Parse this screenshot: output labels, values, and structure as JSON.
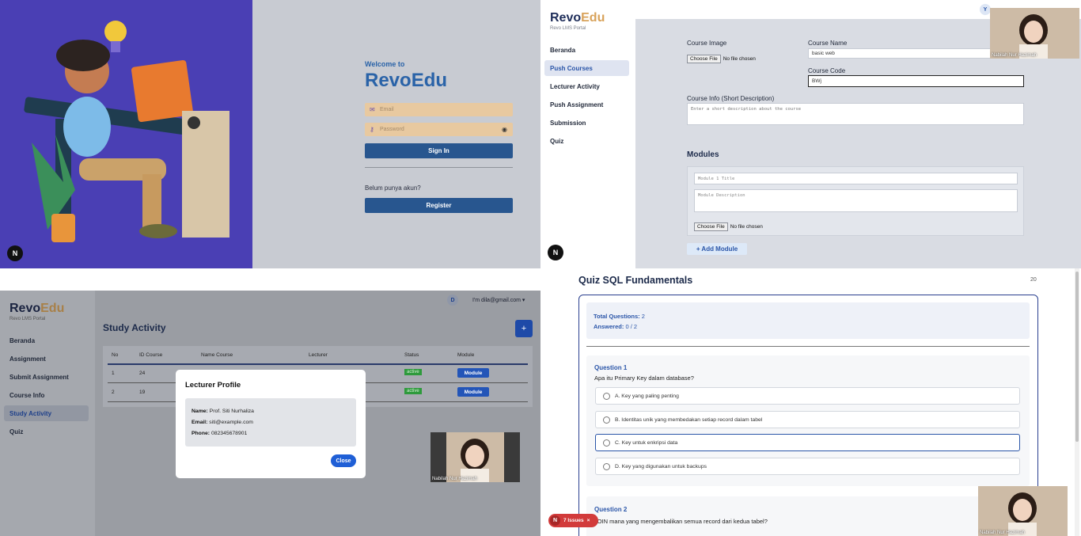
{
  "login": {
    "welcome": "Welcome to",
    "brand": "RevoEdu",
    "email_placeholder": "Email",
    "password_placeholder": "Password",
    "sign_in": "Sign In",
    "no_account": "Belum punya akun?",
    "register": "Register",
    "n_badge": "N"
  },
  "push": {
    "brand_revo": "Revo",
    "brand_edu": "Edu",
    "brand_sub": "Revo LMS Portal",
    "nav": [
      {
        "label": "Beranda"
      },
      {
        "label": "Push Courses"
      },
      {
        "label": "Lecturer Activity"
      },
      {
        "label": "Push Assignment"
      },
      {
        "label": "Submission"
      },
      {
        "label": "Quiz"
      }
    ],
    "avatar_letter": "Y",
    "course_image_label": "Course Image",
    "choose_file": "Choose File",
    "no_file": "No file chosen",
    "course_name_label": "Course Name",
    "course_name_value": "basic web",
    "course_code_label": "Course Code",
    "course_code_value": "BWj",
    "course_info_label": "Course Info (Short Description)",
    "course_info_placeholder": "Enter a short description about the course",
    "modules_title": "Modules",
    "module_title_placeholder": "Module 1 Title",
    "module_desc_placeholder": "Module Description",
    "add_module": "+ Add Module",
    "n_badge": "N",
    "video_name": "Nabilah Nur Hazimah"
  },
  "study": {
    "brand_revo": "Revo",
    "brand_edu": "Edu",
    "brand_sub": "Revo LMS Portal",
    "nav": [
      {
        "label": "Beranda"
      },
      {
        "label": "Assignment"
      },
      {
        "label": "Submit Assignment"
      },
      {
        "label": "Course Info"
      },
      {
        "label": "Study Activity"
      },
      {
        "label": "Quiz"
      }
    ],
    "avatar_letter": "D",
    "user_menu": "I'm dila@gmail.com ▾",
    "title": "Study Activity",
    "add": "+",
    "columns": [
      "No",
      "ID Course",
      "Name Course",
      "Lecturer",
      "Status",
      "Module"
    ],
    "rows": [
      {
        "no": "1",
        "id": "24",
        "status": "active",
        "module": "Module"
      },
      {
        "no": "2",
        "id": "19",
        "status": "active",
        "module": "Module"
      }
    ],
    "modal": {
      "title": "Lecturer Profile",
      "name_label": "Name:",
      "name": "Prof. Siti Nurhaliza",
      "email_label": "Email:",
      "email": "siti@example.com",
      "phone_label": "Phone:",
      "phone": "082345678901",
      "close": "Close"
    },
    "video_name": "Nabilah Nur Hazimah"
  },
  "quiz": {
    "title": "Quiz SQL Fundamentals",
    "timer": "20",
    "total_label": "Total Questions:",
    "total": "2",
    "answered_label": "Answered:",
    "answered": "0 / 2",
    "q1_head": "Question 1",
    "q1_text": "Apa itu Primary Key dalam database?",
    "options": [
      "A. Key yang paling penting",
      "B. Identitas unik yang membedakan setiap record dalam tabel",
      "C. Key untuk enkripsi data",
      "D. Key yang digunakan untuk backups"
    ],
    "q2_head": "Question 2",
    "q2_text": "JOIN mana yang mengembalikan semua record dari kedua tabel?",
    "issues": "7 Issues",
    "issues_close": "×",
    "n_badge": "N",
    "video_name": "Nabilah Nur Hazimah"
  },
  "colors": {
    "primary": "#28568f",
    "accent": "#d8a25a",
    "illustration_bg": "#4a3fb4",
    "active_green": "#2e9a3c"
  }
}
